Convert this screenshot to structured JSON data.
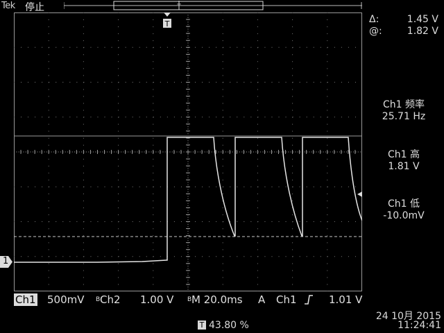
{
  "header": {
    "brand": "Tek",
    "status": "停止"
  },
  "cursor_readout": {
    "delta_label": "Δ:",
    "delta_value": "1.45 V",
    "at_label": "@:",
    "at_value": "1.82 V"
  },
  "measurements": [
    {
      "label": "Ch1 频率",
      "value": "25.71 Hz"
    },
    {
      "label": "Ch1 高",
      "value": "1.81 V"
    },
    {
      "label": "Ch1 低",
      "value": "-10.0mV"
    }
  ],
  "bottom": {
    "ch1_label": "Ch1",
    "ch1_scale": "500mV",
    "bw1": "B",
    "ch2_label": "Ch2",
    "ch2_scale": "1.00 V",
    "bw2": "B",
    "timebase": "M 20.0ms",
    "trigger_mode": "A",
    "trigger_source": "Ch1",
    "trigger_slope_icon": "rising-edge-icon",
    "trigger_level": "1.01 V"
  },
  "datetime": {
    "date": "24 10月 2015",
    "time": "11:24:41"
  },
  "trigger_position": {
    "marker": "T",
    "value": "43.80 %"
  },
  "channel_marker": "1",
  "colors": {
    "trace": "#e6e6e6",
    "grid": "#8a8a8a",
    "background": "#000000"
  }
}
